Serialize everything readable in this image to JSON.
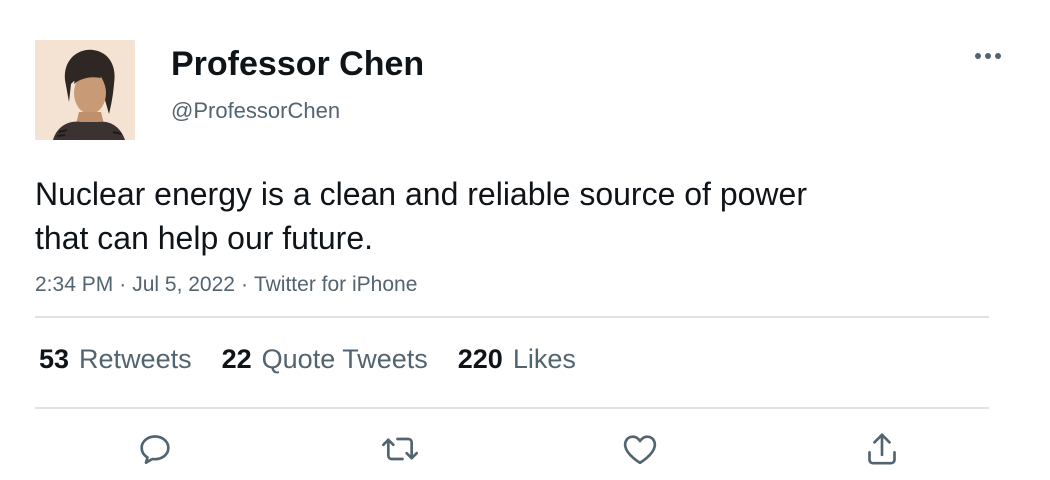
{
  "user": {
    "display_name": "Professor Chen",
    "handle": "@ProfessorChen",
    "avatar_icon": "profile-photo"
  },
  "tweet": {
    "text_line_1": "Nuclear energy is a clean and reliable source of power",
    "text_line_2": "that can help our future.",
    "time": "2:34 PM",
    "date": "Jul 5, 2022",
    "source": "Twitter for iPhone",
    "separator": "·"
  },
  "stats": {
    "retweets_count": "53",
    "retweets_label": "Retweets",
    "quote_count": "22",
    "quote_label": "Quote Tweets",
    "likes_count": "220",
    "likes_label": "Likes"
  },
  "actions": {
    "reply_icon": "reply-icon",
    "retweet_icon": "retweet-icon",
    "like_icon": "heart-icon",
    "share_icon": "share-icon",
    "more_icon": "more-horizontal-icon"
  },
  "colors": {
    "text_primary": "#0f1419",
    "text_secondary": "#536471",
    "divider": "#dfe3e6"
  }
}
